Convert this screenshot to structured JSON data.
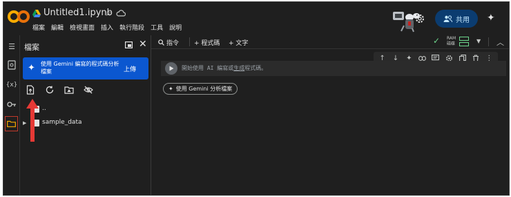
{
  "header": {
    "title": "Untitled1.ipynb",
    "menu": [
      "檔案",
      "編輯",
      "檢視畫面",
      "插入",
      "執行階段",
      "工具",
      "說明"
    ],
    "share_label": "共用"
  },
  "file_panel": {
    "title": "檔案",
    "gemini_banner_text": "使用 Gemini 編寫的程式碼分析檔案",
    "upload_label": "上傳",
    "tree": [
      {
        "name": "..",
        "expandable": false
      },
      {
        "name": "sample_data",
        "expandable": true
      }
    ]
  },
  "main": {
    "toolbar": {
      "command_label": "指令",
      "code_label": "+ 程式碼",
      "text_label": "+ 文字",
      "ram_label": "RAM",
      "disk_label": "磁碟"
    },
    "cell_placeholder_part1": "開始使用 AI 編寫或",
    "cell_placeholder_link": "生成",
    "cell_placeholder_part2": "程式碼。",
    "gemini_pill": "使用 Gemini 分析檔案"
  },
  "colors": {
    "background": "#1f1f1f",
    "gemini_blue": "#0b57d0",
    "share_button": "#0b3c70",
    "annotation_red": "#e53935",
    "status_green": "#6dd58c"
  },
  "icons": [
    "colab-logo-icon",
    "drive-icon",
    "star-icon",
    "cloud-icon",
    "settings-icon",
    "people-icon",
    "sparkle-icon",
    "toc-icon",
    "search-icon",
    "variables-icon",
    "key-icon",
    "folder-icon",
    "new-window-icon",
    "close-icon",
    "upload-file-icon",
    "refresh-icon",
    "drive-folder-icon",
    "hidden-icon",
    "run-icon",
    "arrow-up-icon",
    "arrow-down-icon",
    "link-icon",
    "comment-icon",
    "mirror-icon",
    "delete-icon",
    "more-icon",
    "chevron-up-icon"
  ]
}
